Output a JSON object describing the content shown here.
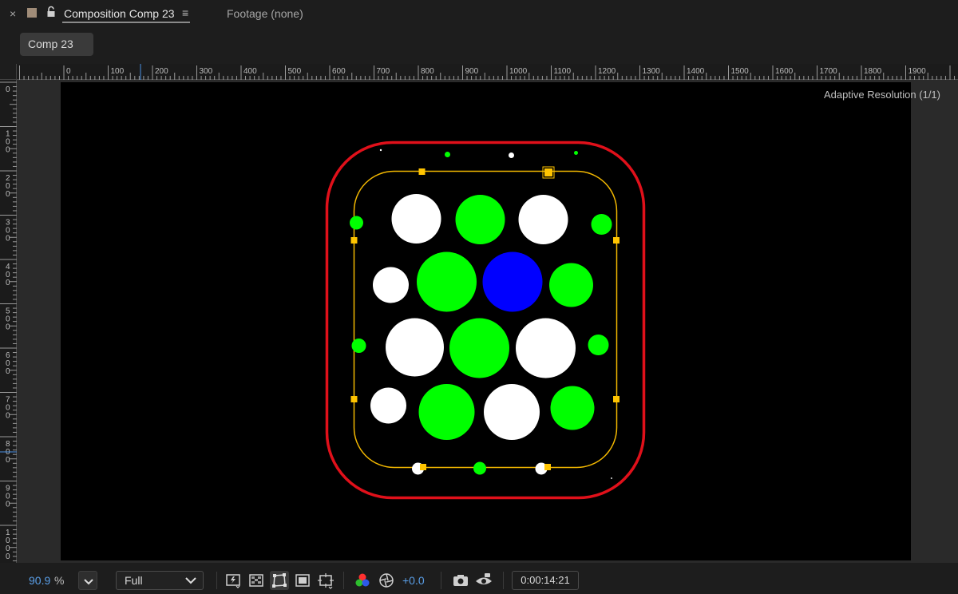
{
  "tabs": {
    "close_glyph": "×",
    "composition_title": "Composition Comp 23",
    "menu_glyph": "≡",
    "footage_title": "Footage (none)",
    "label_color": "#a08c78"
  },
  "navigator": {
    "comp_chip": "Comp 23"
  },
  "ruler": {
    "h_labels": [
      "0",
      "100",
      "200",
      "300",
      "400",
      "500",
      "600",
      "700",
      "800",
      "900",
      "1000",
      "1100",
      "1200",
      "1300",
      "1400",
      "1500",
      "1600",
      "1700",
      "1800",
      "1900"
    ],
    "v_labels": [
      "0",
      "100",
      "200",
      "300",
      "400",
      "500",
      "600",
      "700",
      "800",
      "900",
      "1000"
    ]
  },
  "viewer": {
    "adaptive_label": "Adaptive Resolution (1/1)",
    "colors": {
      "outer_frame": "#e0101a",
      "mask_path": "#f2b700",
      "handles": "#ffc400",
      "circle_green": "#00ff00",
      "circle_white": "#ffffff",
      "circle_blue": "#0000ff"
    }
  },
  "toolbar": {
    "zoom_value": "90.9",
    "zoom_unit": "%",
    "resolution": "Full",
    "exposure": "+0.0",
    "timecode": "0:00:14:21",
    "icons": [
      "fast-previews-icon",
      "transparency-grid-icon",
      "mask-visibility-icon",
      "region-of-interest-icon",
      "grid-guides-icon",
      "color-channels-icon",
      "color-management-icon",
      "snapshot-icon",
      "show-snapshot-icon"
    ]
  }
}
